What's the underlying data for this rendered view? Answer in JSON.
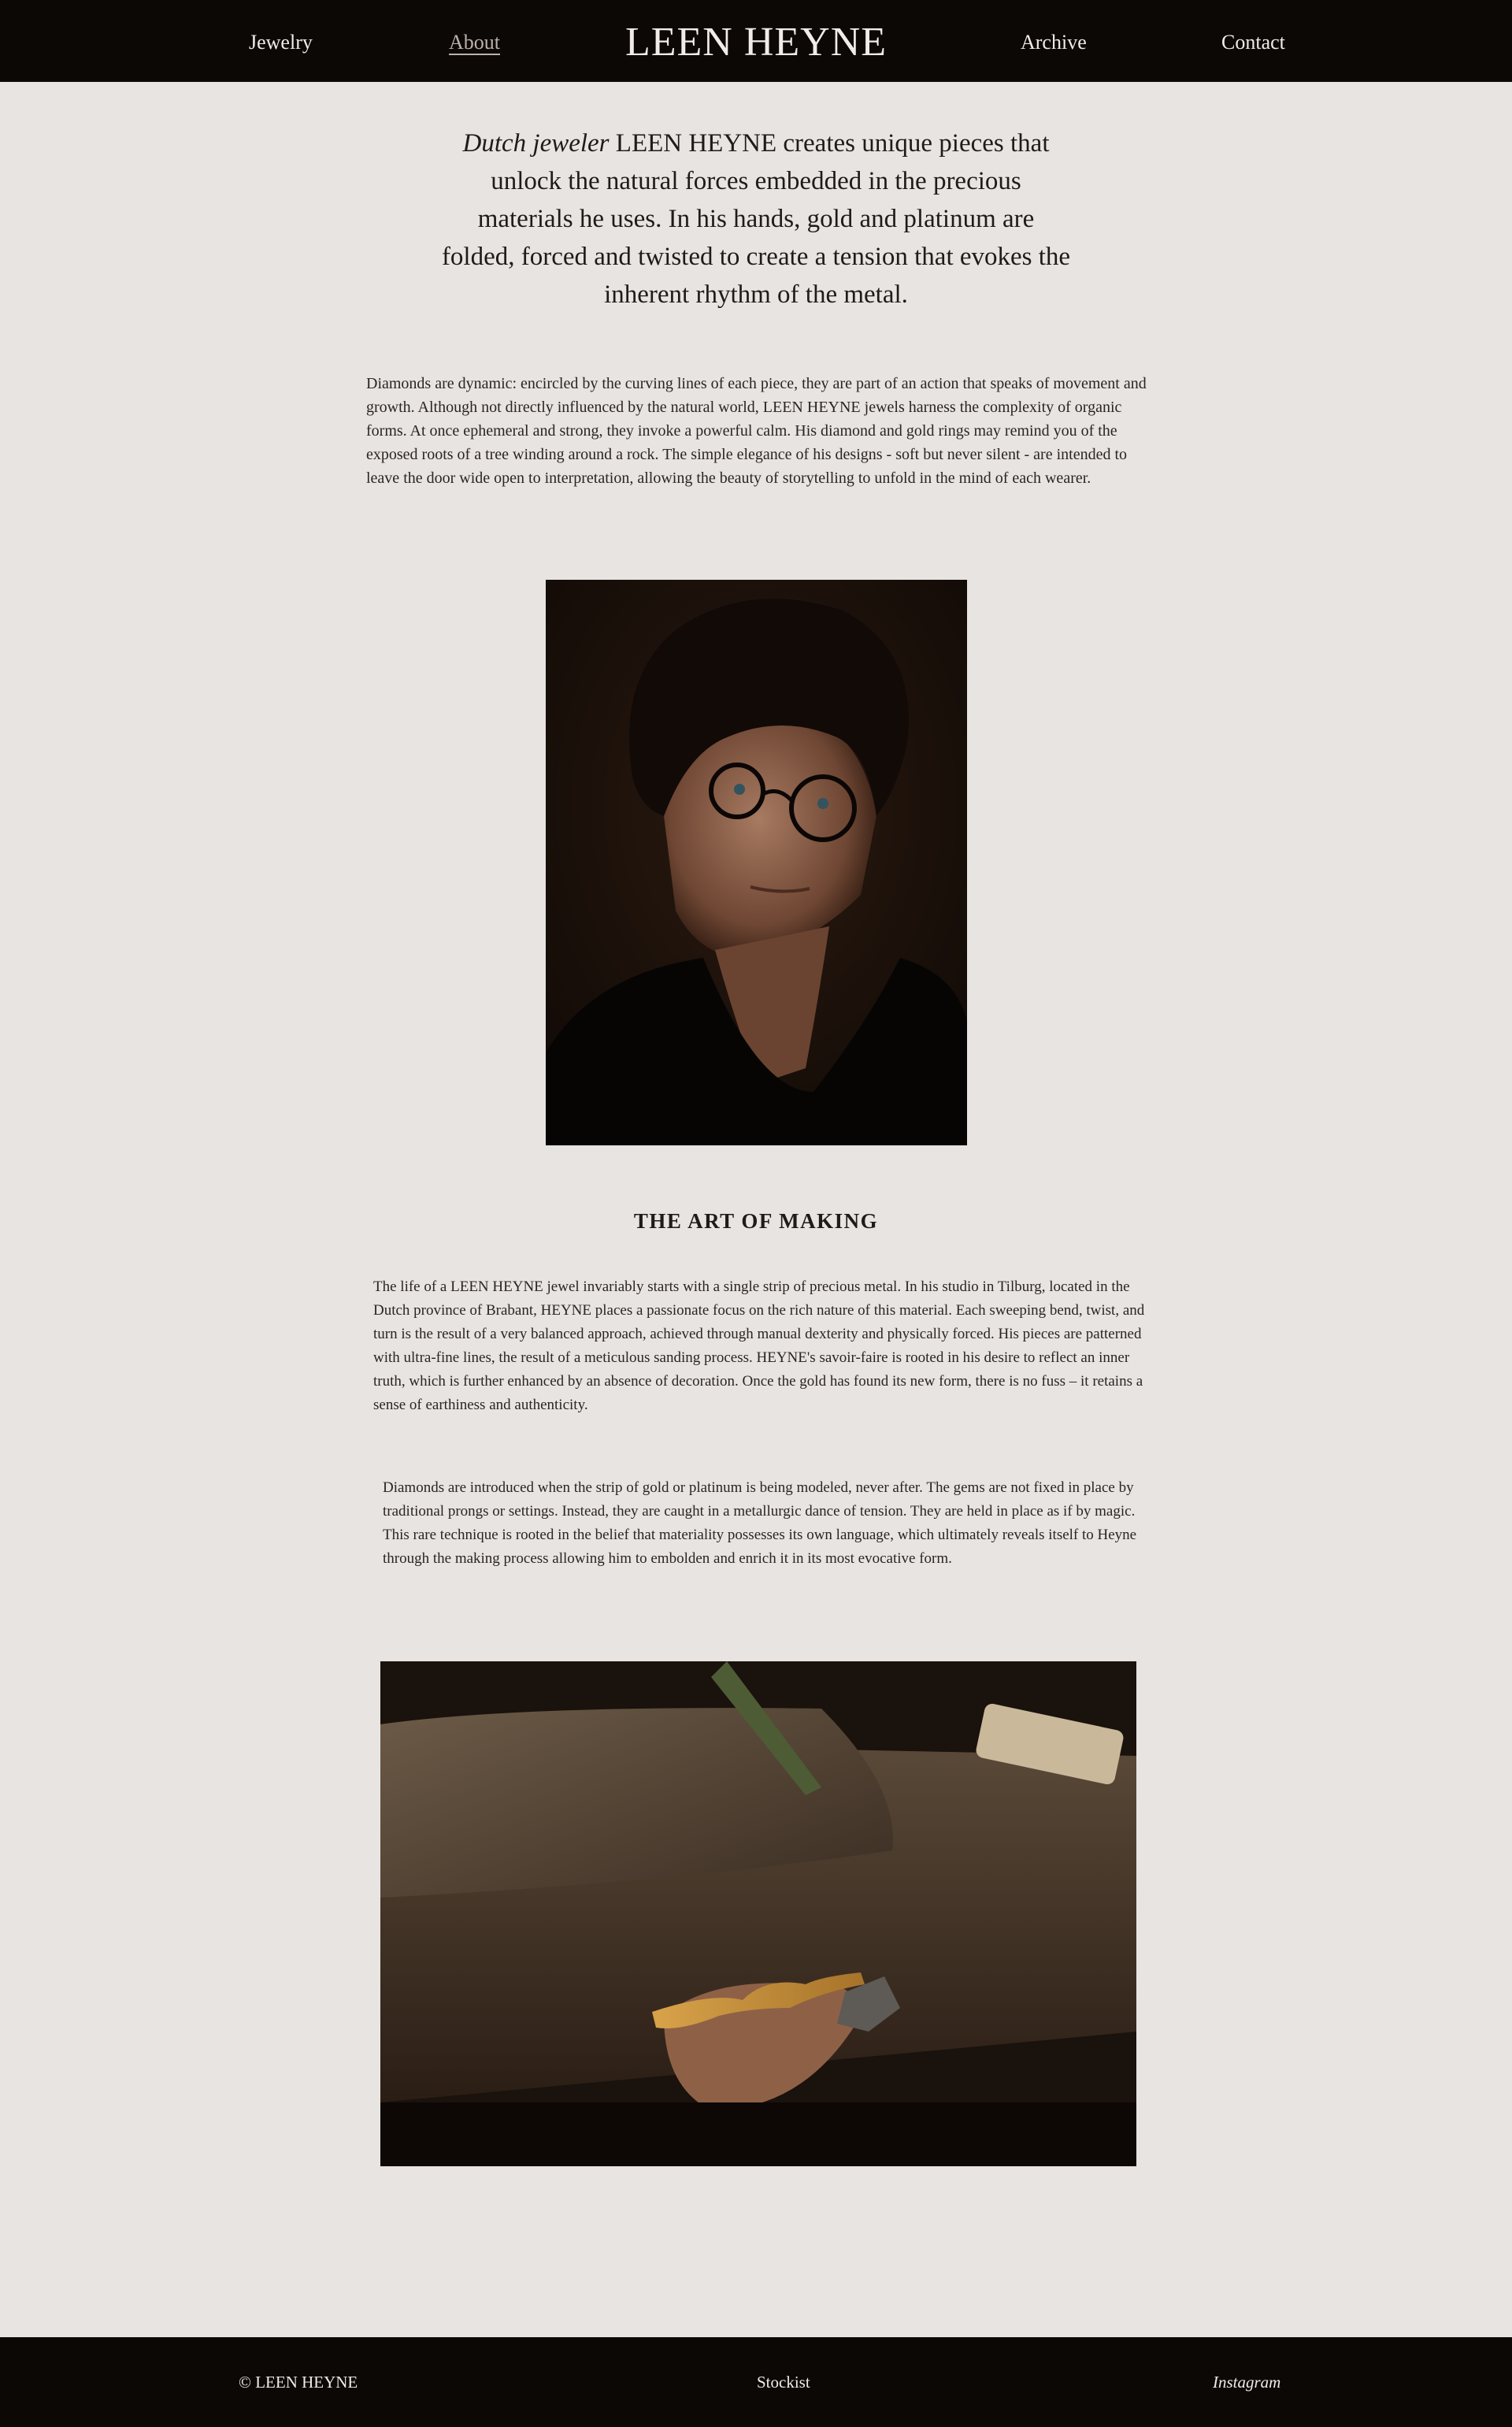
{
  "nav": {
    "left_links": [
      "Jewelry",
      "About"
    ],
    "brand": "LEEN HEYNE",
    "right_links": [
      "Archive",
      "Contact"
    ],
    "active": "About"
  },
  "intro": {
    "lead_italic": "Dutch jeweler",
    "text": " LEEN HEYNE creates unique pieces that unlock the natural forces embedded in the precious materials he uses. In his hands, gold and platinum are folded, forced and twisted to create a tension that evokes the inherent rhythm of the metal."
  },
  "paragraph_1": "Diamonds are dynamic: encircled by the curving lines of each piece, they are part of an action that speaks of movement and growth. Although not directly influenced by the natural world, LEEN HEYNE jewels harness the complexity of organic forms. At once ephemeral and strong, they invoke a powerful calm. His diamond and gold rings may remind you of the exposed roots of a tree winding around a rock. The simple elegance of his designs - soft but never silent - are intended to leave the door wide open to interpretation, allowing the beauty of storytelling to unfold in the mind of each wearer.",
  "section_title": "THE ART OF MAKING",
  "paragraph_2": "The life of a LEEN HEYNE jewel invariably starts with a single strip of precious metal. In his studio in Tilburg, located in the Dutch province of Brabant, HEYNE places a passionate focus on the rich nature of this material. Each sweeping bend, twist, and turn is the result of a very balanced approach, achieved through manual dexterity and physically forced. His pieces are patterned with ultra-fine lines, the result of a meticulous sanding process. HEYNE's savoir-faire is rooted in his desire to reflect an inner truth, which is further enhanced by an absence of decoration. Once the gold has found its new form, there is no fuss – it retains a sense of earthiness and authenticity.",
  "paragraph_3": "Diamonds are introduced when the strip of gold or platinum is being modeled, never after. The gems are not fixed in place by traditional prongs or settings. Instead, they are caught in a metallurgic dance of tension. They are held in place as if by magic. This rare technique is rooted in the belief that materiality possesses its own language, which ultimately reveals itself to Heyne through the making process allowing him to embolden and enrich it in its most evocative form.",
  "footer": {
    "copyright": "© LEEN HEYNE",
    "stockist": "Stockist",
    "instagram": "Instagram"
  },
  "colors": {
    "bar_background": "#0c0806",
    "page_background": "#e8e4e1",
    "text": "#1e1b19",
    "bar_text": "#f1ece7"
  }
}
